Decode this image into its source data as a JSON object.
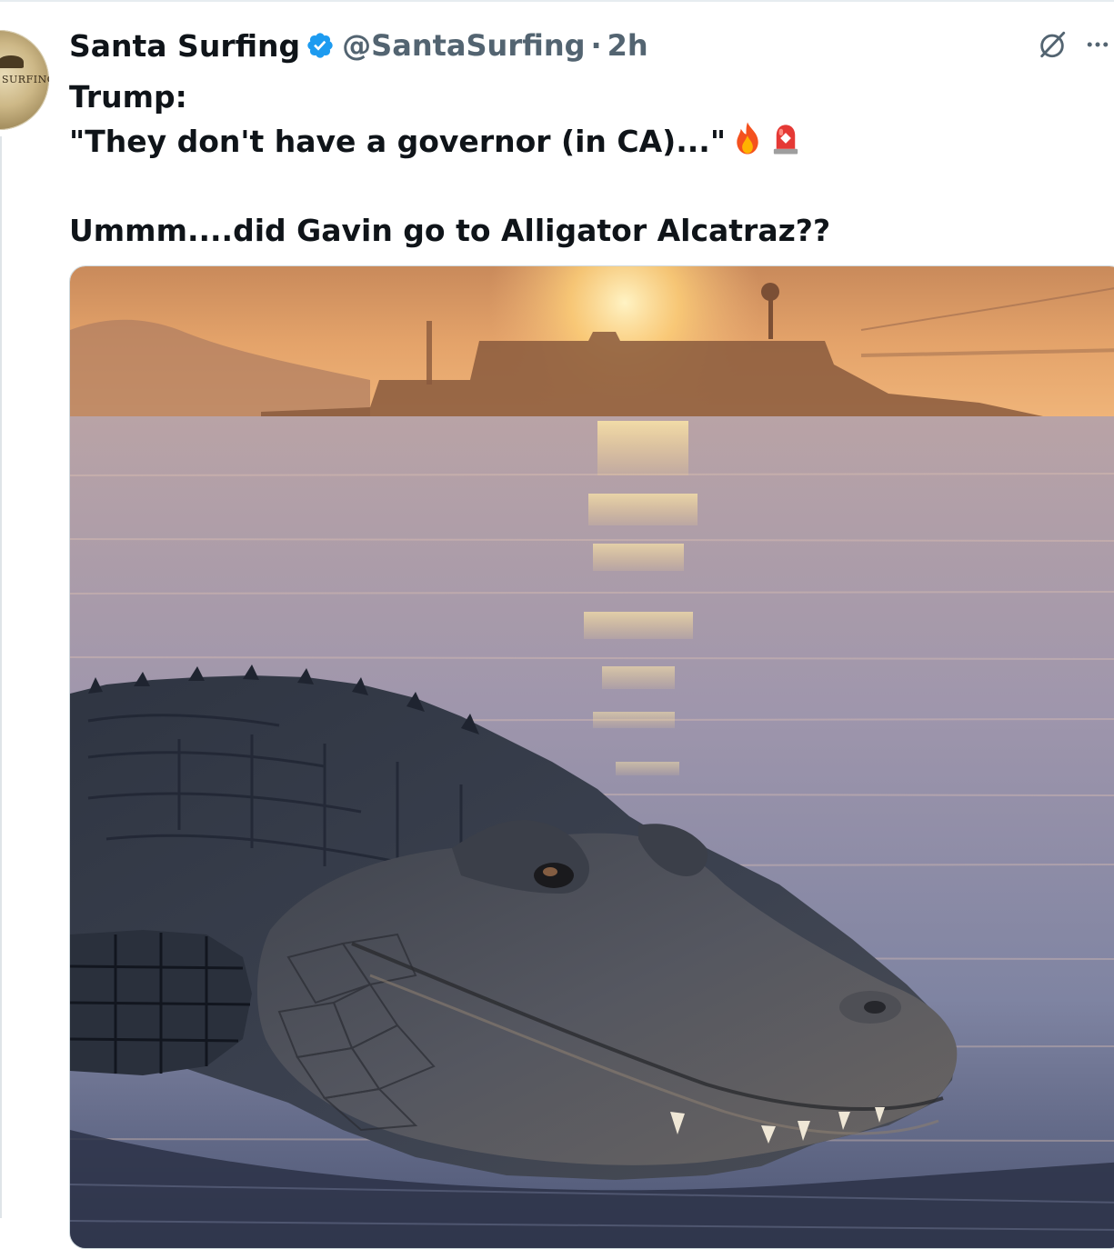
{
  "tweet": {
    "author_name": "Santa Surfing",
    "handle": "@SantaSurfing",
    "separator": "·",
    "time": "2h",
    "lines": [
      "Trump:",
      "\"They don't have a governor (in CA)...\"",
      "",
      "Ummm....did Gavin go to Alligator Alcatraz??"
    ],
    "emojis": [
      "fire",
      "rotating-light"
    ],
    "avatar_text": "SURFING"
  },
  "icons": {
    "verified": "verified-badge-icon",
    "grok": "grok-icon",
    "more": "more-icon"
  },
  "colors": {
    "text_primary": "#0f1419",
    "text_secondary": "#536471",
    "verified_blue": "#1d9bf0"
  },
  "media": {
    "type": "image",
    "subject": "alligator at sunset with island prison silhouette"
  }
}
